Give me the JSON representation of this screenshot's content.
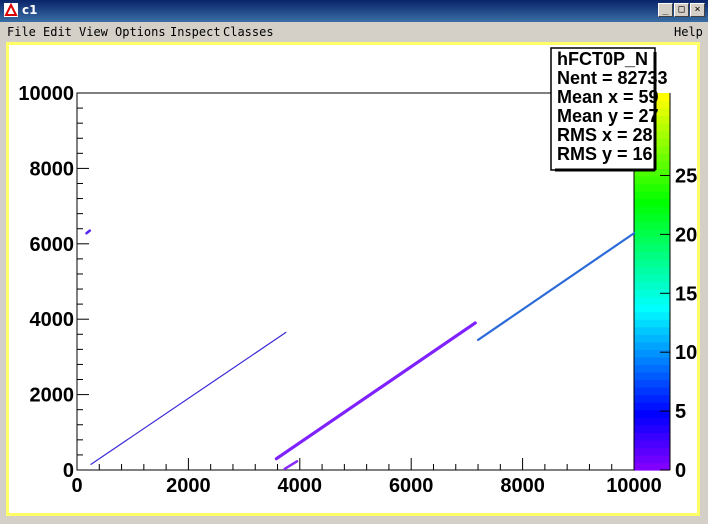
{
  "window": {
    "title": "c1",
    "minimize_label": "_",
    "maximize_label": "□",
    "close_label": "×"
  },
  "menu": {
    "file": "File",
    "edit": "Edit",
    "view": "View",
    "options": "Options",
    "inspect": "Inspect",
    "classes": "Classes",
    "help": "Help"
  },
  "stats_box": {
    "name": "hFCT0P_N",
    "lines": [
      "Nent = 82733",
      "Mean x =   59",
      "Mean y =   27",
      "RMS x  =   28",
      "RMS y  =   16"
    ]
  },
  "colors": {
    "palette_low": "#7f00ff",
    "palette_high": "#ffff00",
    "frame": "#ffff66"
  },
  "chart_data": {
    "type": "scatter",
    "title": "",
    "xlabel": "",
    "ylabel": "",
    "xlim": [
      0,
      10000
    ],
    "ylim": [
      0,
      10000
    ],
    "x_ticks": [
      "0",
      "2000",
      "4000",
      "6000",
      "8000",
      "10000"
    ],
    "y_ticks": [
      "0",
      "2000",
      "4000",
      "6000",
      "8000",
      "10000"
    ],
    "z_ticks": [
      "0",
      "5",
      "10",
      "15",
      "20",
      "25"
    ],
    "zlim": [
      0,
      32
    ],
    "series": [
      {
        "x": [
          250,
          3750
        ],
        "y": [
          150,
          3650
        ],
        "color": "#3b2ad6",
        "width": 1.2
      },
      {
        "x": [
          3580,
          7150
        ],
        "y": [
          300,
          3900
        ],
        "color": "#7f22ff",
        "width": 3.2
      },
      {
        "x": [
          3730,
          3950
        ],
        "y": [
          30,
          230
        ],
        "color": "#8a2bff",
        "width": 2.5
      },
      {
        "x": [
          7200,
          10000
        ],
        "y": [
          3450,
          6280
        ],
        "color": "#2c6cd9",
        "width": 2.2
      },
      {
        "x": [
          170,
          230
        ],
        "y": [
          6280,
          6350
        ],
        "color": "#5a22ff",
        "width": 2.5
      }
    ]
  }
}
